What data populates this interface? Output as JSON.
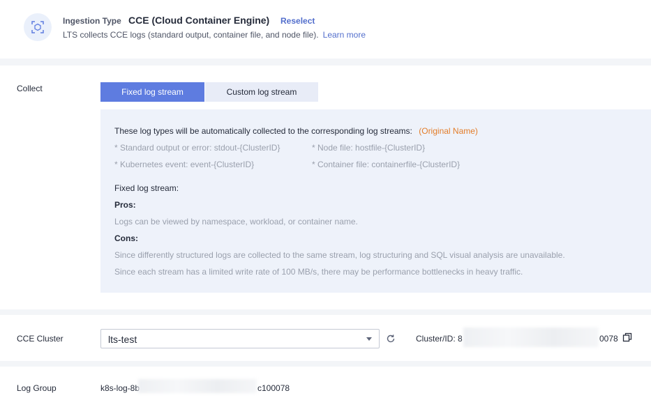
{
  "ingestion": {
    "label": "Ingestion Type",
    "value": "CCE (Cloud Container Engine)",
    "reselect": "Reselect",
    "description": "LTS collects CCE logs (standard output, container file, and node file).",
    "learn_more": "Learn more",
    "icon": "scan-container-icon"
  },
  "collect": {
    "label": "Collect",
    "tabs": [
      {
        "label": "Fixed log stream",
        "active": true
      },
      {
        "label": "Custom log stream",
        "active": false
      }
    ],
    "info": {
      "intro": "These log types will be automatically collected to the corresponding log streams:",
      "original_name": "(Original Name)",
      "item1": "* Standard output or error: stdout-{ClusterID}",
      "item2": "* Node file: hostfile-{ClusterID}",
      "item3": "* Kubernetes event: event-{ClusterID}",
      "item4": "* Container file: containerfile-{ClusterID}",
      "fixed_heading": "Fixed log stream:",
      "pros_label": "Pros:",
      "pros_text": "Logs can be viewed by namespace, workload, or container name.",
      "cons_label": "Cons:",
      "cons_text1": "Since differently structured logs are collected to the same stream, log structuring and SQL visual analysis are unavailable.",
      "cons_text2": "Since each stream has a limited write rate of 100 MB/s, there may be performance bottlenecks in heavy traffic."
    }
  },
  "cluster": {
    "label": "CCE Cluster",
    "selected": "lts-test",
    "id_label": "Cluster/ID:",
    "id_prefix": "8",
    "id_suffix": "0078"
  },
  "log_group": {
    "label": "Log Group",
    "value_prefix": "k8s-log-8b",
    "value_suffix": "c100078"
  },
  "colors": {
    "accent": "#5e7ce0",
    "link": "#526ecc",
    "highlight": "#e37d29"
  }
}
